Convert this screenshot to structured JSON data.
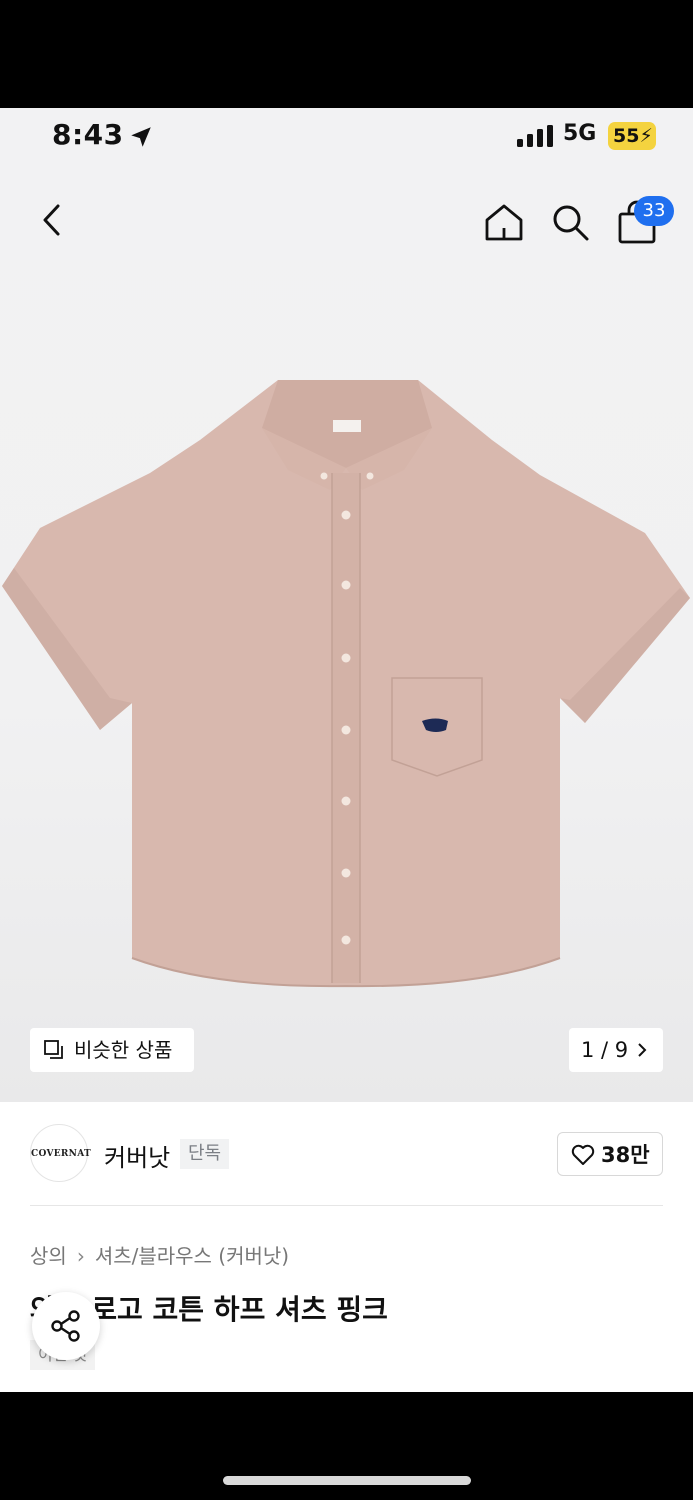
{
  "status_bar": {
    "time": "8:43",
    "network": "5G",
    "battery": "55"
  },
  "nav": {
    "cart_count": "33"
  },
  "gallery": {
    "similar_label": "비슷한 상품",
    "pager": "1 / 9"
  },
  "brand": {
    "logo_text": "COVERNAT",
    "name": "커버낫",
    "badge": "단독",
    "likes": "38만"
  },
  "breadcrumb": {
    "level1": "상의",
    "level2": "셔츠/블라우스 (커버낫)"
  },
  "product": {
    "title": "와펜 로고 코튼 하프 셔츠 핑크",
    "tag": "이번 것"
  },
  "colors": {
    "accent": "#1f6fef",
    "battery": "#f4d33f",
    "shirt": "#d8b8ae"
  }
}
